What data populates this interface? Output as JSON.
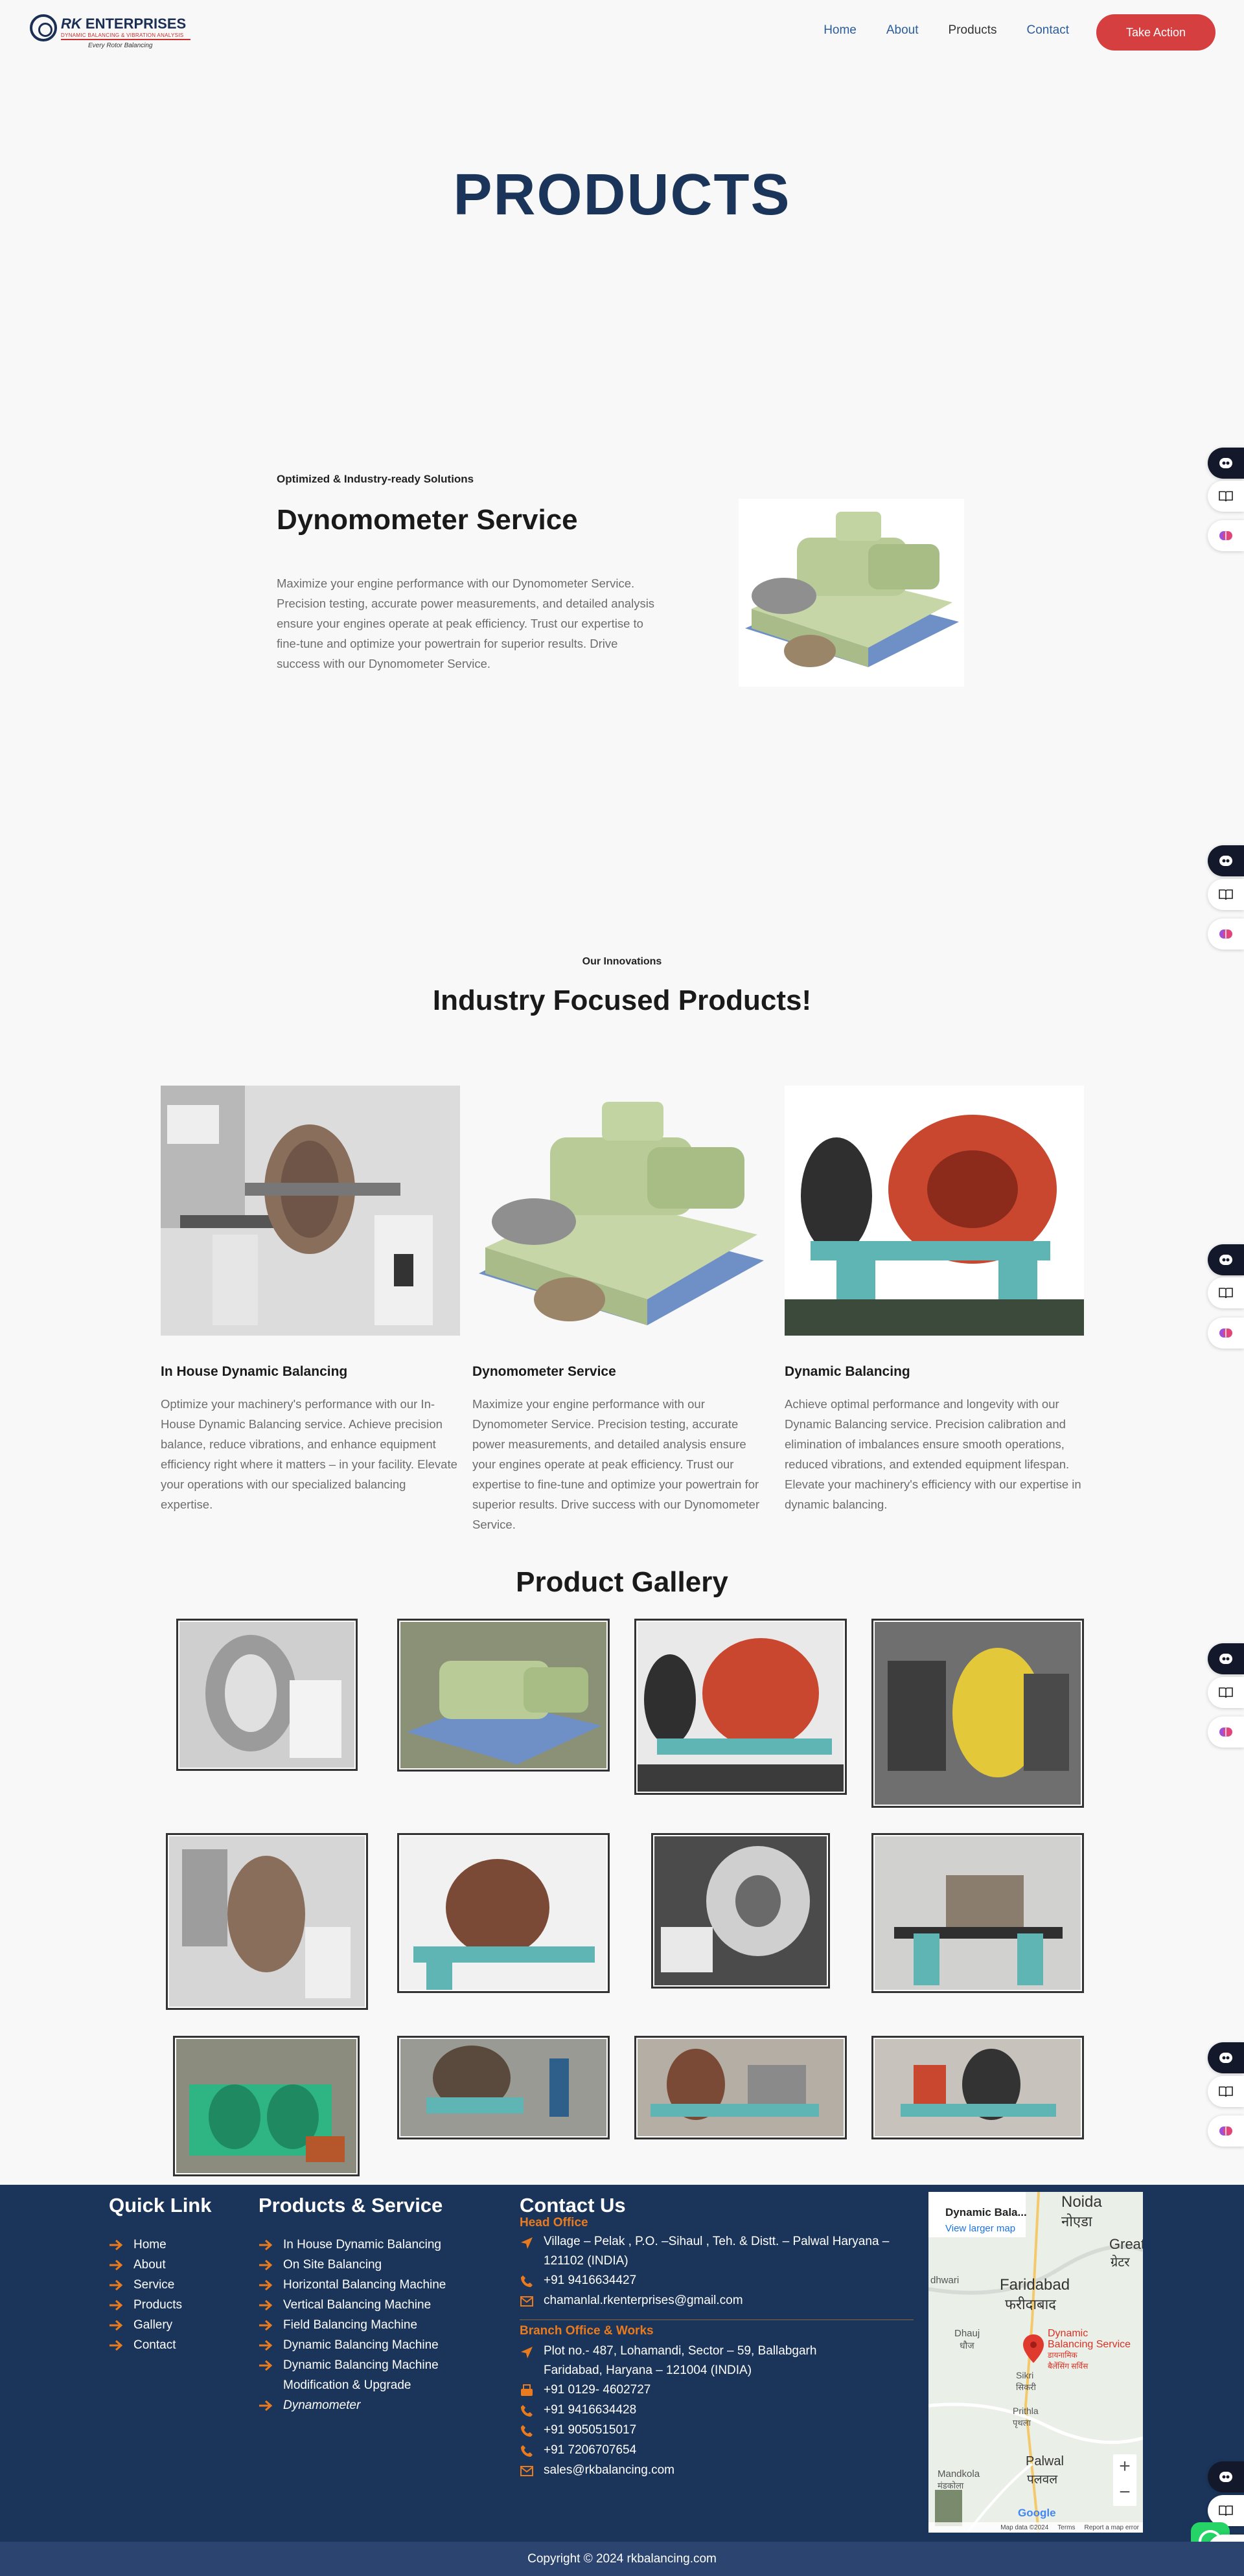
{
  "header": {
    "logo": {
      "brand_prefix": "RK",
      "brand_name": "ENTERPRISES",
      "tagline": "DYNAMIC BALANCING & VIBRATION ANALYSIS",
      "motto": "Every Rotor Balancing"
    },
    "nav": [
      {
        "label": "Home"
      },
      {
        "label": "About"
      },
      {
        "label": "Products"
      },
      {
        "label": "Contact"
      }
    ],
    "cta_label": "Take Action"
  },
  "page_title": "PRODUCTS",
  "feature": {
    "eyebrow": "Optimized & Industry-ready Solutions",
    "title": "Dynomometer Service",
    "text": "Maximize your engine performance with our Dynomometer Service. Precision testing, accurate power measurements, and detailed analysis ensure your engines operate at peak efficiency. Trust our expertise to fine-tune and optimize your powertrain for superior results. Drive success with our Dynomometer Service."
  },
  "innovations": {
    "eyebrow": "Our Innovations",
    "title": "Industry Focused Products!",
    "cards": [
      {
        "title": "In House Dynamic Balancing",
        "text": "Optimize your machinery's performance with our In-House Dynamic Balancing service. Achieve precision balance, reduce vibrations, and enhance equipment efficiency right where it matters – in your facility. Elevate your operations with our specialized balancing expertise."
      },
      {
        "title": "Dynomometer Service",
        "text": "Maximize your engine performance with our Dynomometer Service. Precision testing, accurate power measurements, and detailed analysis ensure your engines operate at peak efficiency. Trust our expertise to fine-tune and optimize your powertrain for superior results. Drive success with our Dynomometer Service."
      },
      {
        "title": "Dynamic Balancing",
        "text": "Achieve optimal performance and longevity with our Dynamic Balancing service. Precision calibration and elimination of imbalances ensure smooth operations, reduced vibrations, and extended equipment lifespan. Elevate your machinery's efficiency with our expertise in dynamic balancing."
      }
    ]
  },
  "gallery_title": "Product Gallery",
  "footer": {
    "quick_link_heading": "Quick Link",
    "quick_links": [
      "Home",
      "About",
      "Service",
      "Products",
      "Gallery",
      "Contact"
    ],
    "products_heading": "Products & Service",
    "products": [
      "In House Dynamic Balancing",
      "On Site Balancing",
      "Horizontal Balancing Machine",
      "Vertical Balancing Machine",
      "Field Balancing Machine",
      "Dynamic Balancing Machine",
      "Dynamic Balancing Machine",
      "Modification & Upgrade",
      "Dynamometer"
    ],
    "contact_heading": "Contact Us",
    "head_office_label": "Head Office",
    "head_office_address_1": "Village – Pelak , P.O. –Sihaul , Teh. & Distt. – Palwal Haryana –",
    "head_office_address_2": "121102 (INDIA)",
    "head_office_phone": "+91 9416634427",
    "head_office_email": "chamanlal.rkenterprises@gmail.com",
    "branch_label": "Branch Office & Works",
    "branch_address_1": "Plot no.- 487, Lohamandi, Sector – 59, Ballabgarh",
    "branch_address_2": "Faridabad, Haryana – 121004 (INDIA)",
    "branch_phones": [
      "+91 0129- 4602727",
      "+91 9416634428",
      "+91 9050515017",
      "+91 7206707654"
    ],
    "branch_email": "sales@rkbalancing.com",
    "map": {
      "place_name": "Dynamic Bala...",
      "view_larger": "View larger map",
      "labels": [
        "Noida",
        "नोएडा",
        "Greate",
        "ग्रेटर",
        "Faridabad",
        "फरीदाबाद",
        "Dhauj",
        "धौज",
        "Sikri",
        "सिकरी",
        "Prithla",
        "पृथला",
        "Palwal",
        "पलवल",
        "Mandkola",
        "मंडकोला",
        "dhwari"
      ],
      "pin_label_1": "Dynamic",
      "pin_label_2": "Balancing Service",
      "pin_label_3": "डायनामिक",
      "pin_label_4": "बैलेंसिंग सर्विस",
      "zoom_in": "+",
      "zoom_out": "−",
      "footer_text": [
        "Map data ©2024",
        "Terms",
        "Report a map error"
      ],
      "google": "Google"
    }
  },
  "copyright": "Copyright © 2024 rkbalancing.com",
  "colors": {
    "primary": "#1b3459",
    "accent": "#d63f3f",
    "orange": "#e97b1e",
    "link": "#2b5d9a"
  }
}
